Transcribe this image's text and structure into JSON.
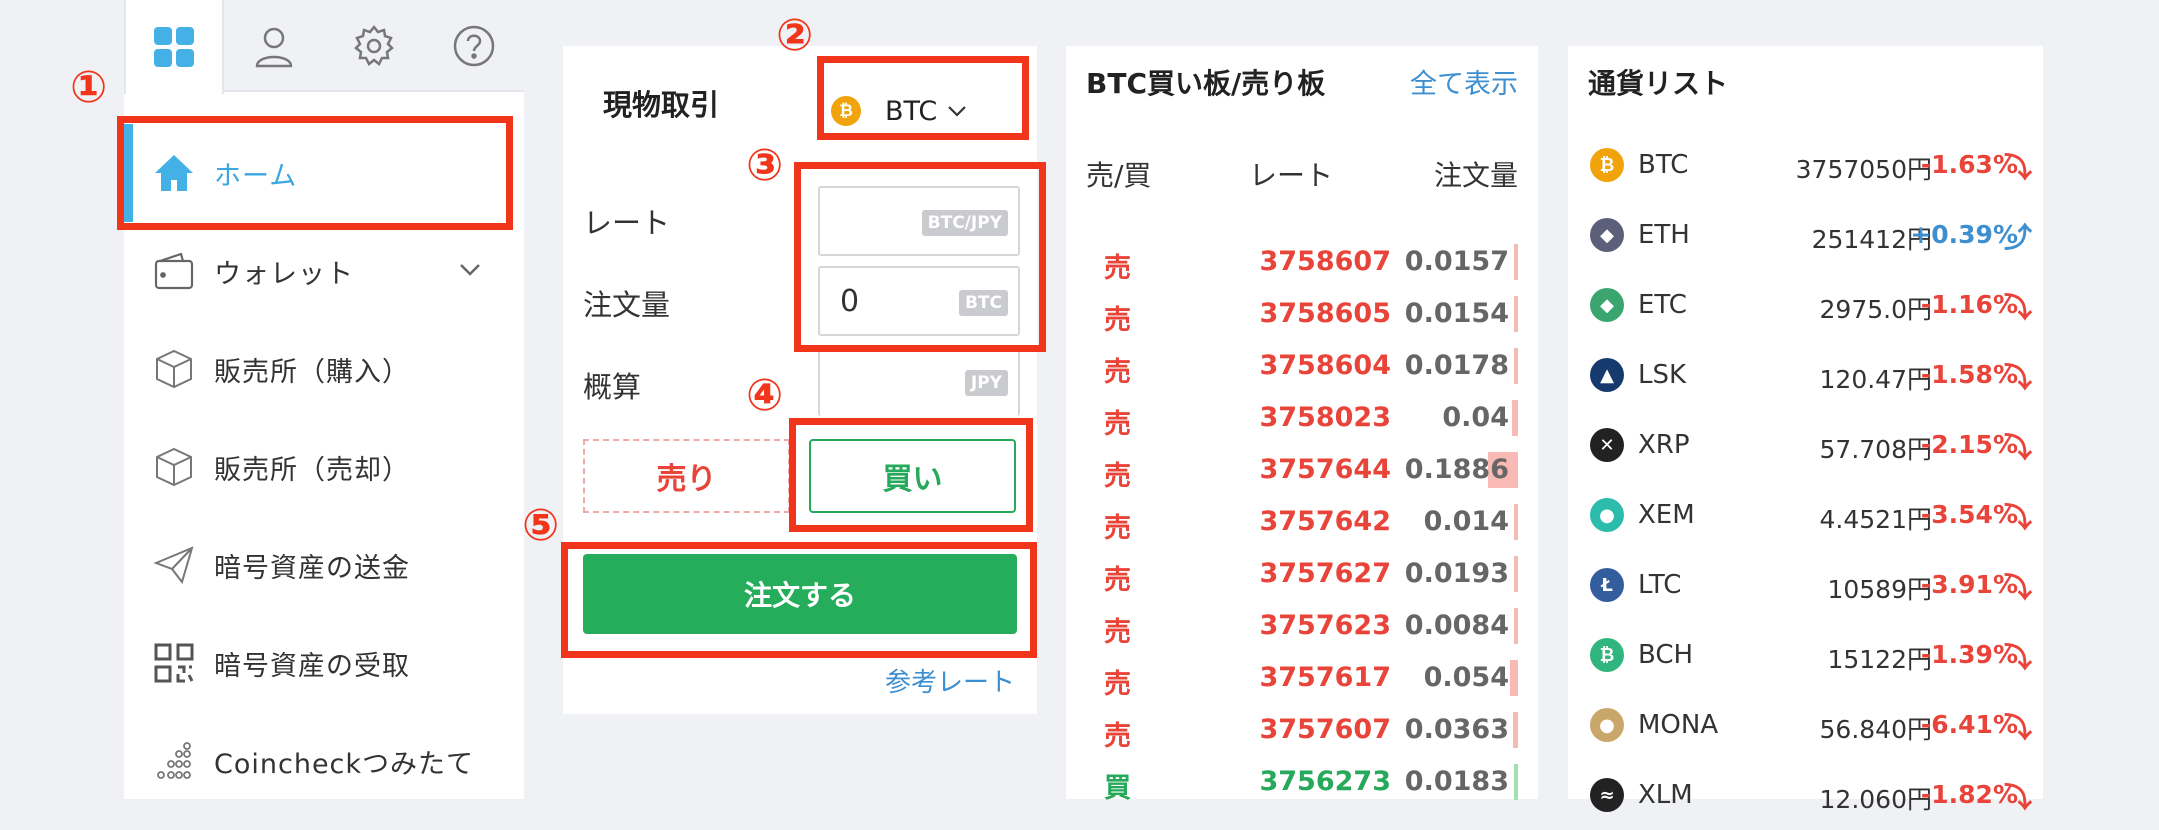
{
  "sidebar": {
    "tabs": [
      {
        "icon": "grid-icon"
      },
      {
        "icon": "user-icon"
      },
      {
        "icon": "gear-icon"
      },
      {
        "icon": "help-icon"
      }
    ],
    "items": [
      {
        "label": "ホーム",
        "icon": "home-icon"
      },
      {
        "label": "ウォレット",
        "icon": "wallet-icon"
      },
      {
        "label": "販売所（購入）",
        "icon": "box-icon"
      },
      {
        "label": "販売所（売却）",
        "icon": "box-icon"
      },
      {
        "label": "暗号資産の送金",
        "icon": "send-icon"
      },
      {
        "label": "暗号資産の受取",
        "icon": "qr-icon"
      },
      {
        "label": "Coincheckつみたて",
        "icon": "dots-icon"
      }
    ]
  },
  "order": {
    "title": "現物取引",
    "coin": "BTC",
    "rate_label": "レート",
    "rate_tag": "BTC/JPY",
    "amount_label": "注文量",
    "amount_value": "0",
    "amount_tag": "BTC",
    "estimate_label": "概算",
    "estimate_tag": "JPY",
    "sell_label": "売り",
    "buy_label": "買い",
    "submit_label": "注文する",
    "ref_link": "参考レート"
  },
  "book": {
    "title": "BTC買い板/売り板",
    "show_all": "全て表示",
    "col_side": "売/買",
    "col_rate": "レート",
    "col_amount": "注文量",
    "rows": [
      {
        "side": "売",
        "rate": "3758607",
        "amount": "0.0157",
        "depth": 0.06
      },
      {
        "side": "売",
        "rate": "3758605",
        "amount": "0.0154",
        "depth": 0.06
      },
      {
        "side": "売",
        "rate": "3758604",
        "amount": "0.0178",
        "depth": 0.07
      },
      {
        "side": "売",
        "rate": "3758023",
        "amount": "0.04",
        "depth": 0.2
      },
      {
        "side": "売",
        "rate": "3757644",
        "amount": "0.1886",
        "depth": 1.0
      },
      {
        "side": "売",
        "rate": "3757642",
        "amount": "0.014",
        "depth": 0.06
      },
      {
        "side": "売",
        "rate": "3757627",
        "amount": "0.0193",
        "depth": 0.08
      },
      {
        "side": "売",
        "rate": "3757623",
        "amount": "0.0084",
        "depth": 0.04
      },
      {
        "side": "売",
        "rate": "3757617",
        "amount": "0.054",
        "depth": 0.25
      },
      {
        "side": "売",
        "rate": "3757607",
        "amount": "0.0363",
        "depth": 0.15
      },
      {
        "side": "買",
        "rate": "3756273",
        "amount": "0.0183",
        "depth": 0.07
      }
    ]
  },
  "currency_list": {
    "title": "通貨リスト",
    "rows": [
      {
        "symbol": "BTC",
        "price": "3757050円",
        "change": "-1.63%",
        "dir": "down",
        "color": "#f0a30a"
      },
      {
        "symbol": "ETH",
        "price": "251412円",
        "change": "+0.39%",
        "dir": "up",
        "color": "#5b5f79"
      },
      {
        "symbol": "ETC",
        "price": "2975.0円",
        "change": "-1.16%",
        "dir": "down",
        "color": "#3ba570"
      },
      {
        "symbol": "LSK",
        "price": "120.47円",
        "change": "-1.58%",
        "dir": "down",
        "color": "#173a6e"
      },
      {
        "symbol": "XRP",
        "price": "57.708円",
        "change": "-2.15%",
        "dir": "down",
        "color": "#222222"
      },
      {
        "symbol": "XEM",
        "price": "4.4521円",
        "change": "-3.54%",
        "dir": "down",
        "color": "#2cbcac"
      },
      {
        "symbol": "LTC",
        "price": "10589円",
        "change": "-3.91%",
        "dir": "down",
        "color": "#345d9d"
      },
      {
        "symbol": "BCH",
        "price": "15122円",
        "change": "-1.39%",
        "dir": "down",
        "color": "#2fb57d"
      },
      {
        "symbol": "MONA",
        "price": "56.840円",
        "change": "-6.41%",
        "dir": "down",
        "color": "#c9a76a"
      },
      {
        "symbol": "XLM",
        "price": "12.060円",
        "change": "-1.82%",
        "dir": "down",
        "color": "#222222"
      }
    ]
  },
  "annotations": [
    "①",
    "②",
    "③",
    "④",
    "⑤"
  ]
}
